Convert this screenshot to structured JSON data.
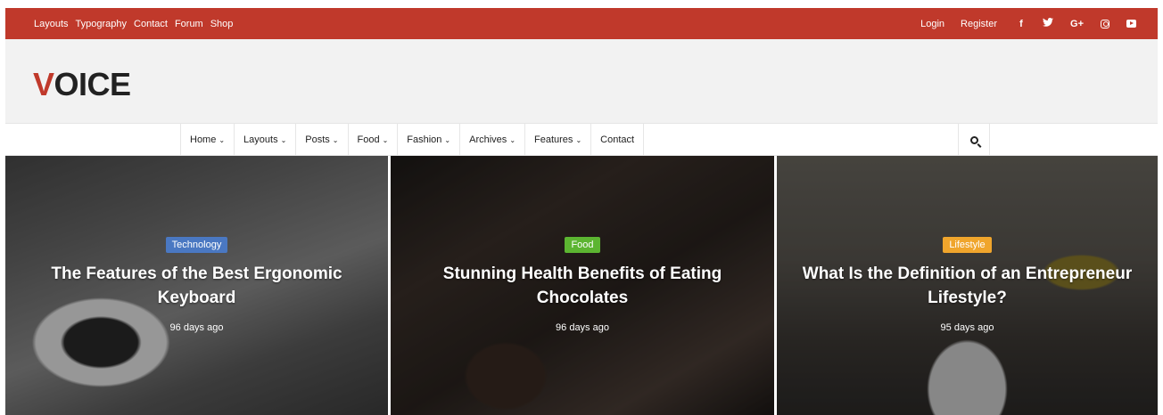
{
  "topbar": {
    "links": [
      "Layouts",
      "Typography",
      "Contact",
      "Forum",
      "Shop"
    ],
    "login": "Login",
    "register": "Register",
    "social": {
      "facebook": "f",
      "twitter": "✔",
      "google": "G+"
    },
    "color": "#c0392b"
  },
  "header": {
    "logo_first": "V",
    "logo_rest": "OICE"
  },
  "nav": {
    "items": [
      {
        "label": "Home",
        "chevron": "⌄"
      },
      {
        "label": "Layouts",
        "chevron": "⌄"
      },
      {
        "label": "Posts",
        "chevron": "⌄"
      },
      {
        "label": "Food",
        "chevron": "⌄"
      },
      {
        "label": "Fashion",
        "chevron": "⌄"
      },
      {
        "label": "Archives",
        "chevron": "⌄"
      },
      {
        "label": "Features",
        "chevron": "⌄"
      },
      {
        "label": "Contact",
        "chevron": ""
      }
    ]
  },
  "posts": [
    {
      "category": "Technology",
      "badge_color": "#4a78c2",
      "title": "The Features of the Best Ergonomic Keyboard",
      "date": "96 days ago"
    },
    {
      "category": "Food",
      "badge_color": "#5cb531",
      "title": "Stunning Health Benefits of Eating Chocolates",
      "date": "96 days ago"
    },
    {
      "category": "Lifestyle",
      "badge_color": "#f0a52c",
      "title": "What Is the Definition of an Entrepreneur Lifestyle?",
      "date": "95 days ago"
    }
  ]
}
